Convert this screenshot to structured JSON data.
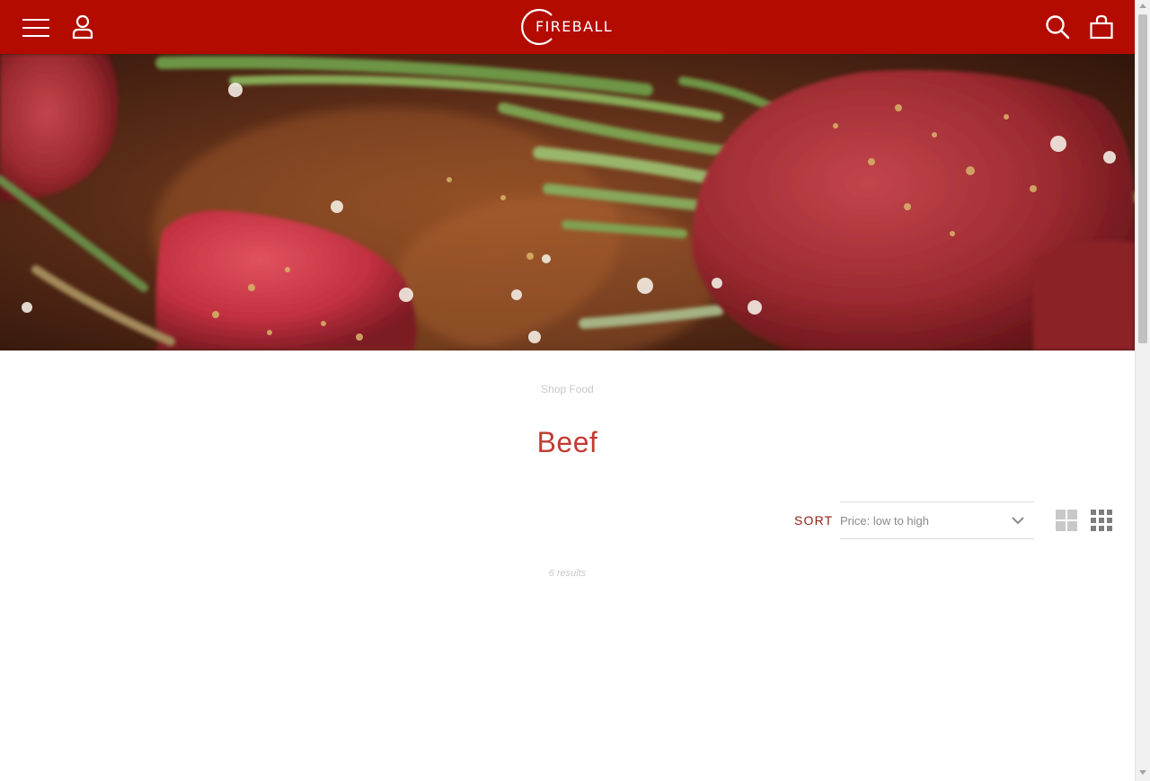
{
  "header": {
    "logo_text": "FIREBALL",
    "brand_color": "#b30b00",
    "icons": [
      "hamburger-menu-icon",
      "account-icon",
      "search-icon",
      "shopping-bag-icon"
    ]
  },
  "hero": {
    "image": "raw seasoned beef cubes with rosemary"
  },
  "breadcrumb": {
    "label": "Shop Food"
  },
  "page": {
    "title": "Beef",
    "title_color": "#c23b33"
  },
  "toolbar": {
    "sort_label": "SORT",
    "sort_value": "Price: low to high",
    "view_options": [
      "grid-large-icon",
      "grid-small-icon"
    ]
  },
  "results": {
    "count_text": "6 results"
  }
}
